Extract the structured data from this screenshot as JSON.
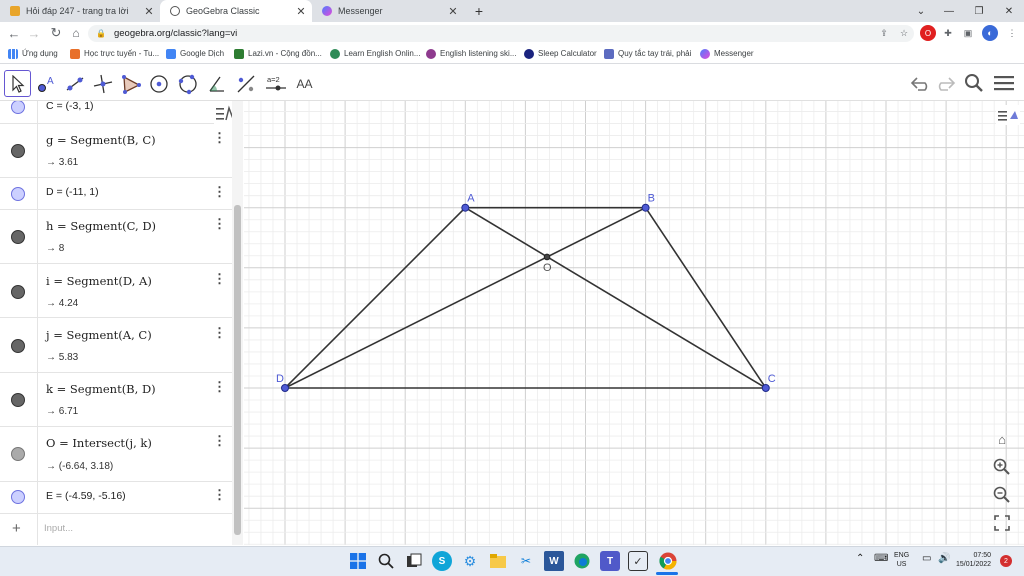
{
  "browser": {
    "tabs": [
      {
        "title": "Hỏi đáp 247 - trang tra lời",
        "active": false
      },
      {
        "title": "GeoGebra Classic",
        "active": true
      },
      {
        "title": "Messenger",
        "active": false
      }
    ],
    "new_tab": "+",
    "url": "geogebra.org/classic?lang=vi",
    "bookmarks": [
      "Ứng dụng",
      "Học trực tuyến - Tu...",
      "Google Dịch",
      "Lazi.vn - Cộng đồn...",
      "Learn English Onlin...",
      "English listening ski...",
      "Sleep Calculator",
      "Quy tắc tay trái, phải",
      "Messenger"
    ]
  },
  "toolbar": {
    "tools": [
      "move",
      "point",
      "line",
      "perpendicular-line",
      "polygon",
      "circle",
      "circle-3-points",
      "angle",
      "reflect",
      "slider",
      "text"
    ],
    "slider_label": "a=2",
    "text_label": "AA"
  },
  "algebra": {
    "input_placeholder": "Input...",
    "add_symbol": "+",
    "rows": [
      {
        "def": "C = (-3, 1)",
        "value": null,
        "marble": "pt"
      },
      {
        "def": "g = Segment(B, C)",
        "value": "→ 3.61",
        "marble": "dk"
      },
      {
        "def": "D = (-11, 1)",
        "value": null,
        "marble": "pt"
      },
      {
        "def": "h = Segment(C, D)",
        "value": "→ 8",
        "marble": "dk"
      },
      {
        "def": "i = Segment(D, A)",
        "value": "→ 4.24",
        "marble": "dk"
      },
      {
        "def": "j = Segment(A, C)",
        "value": "→ 5.83",
        "marble": "dk"
      },
      {
        "def": "k = Segment(B, D)",
        "value": "→ 6.71",
        "marble": "dk"
      },
      {
        "def": "O = Intersect(j, k)",
        "value": "→ (-6.64, 3.18)",
        "marble": "gr"
      },
      {
        "def": "E = (-4.59, -5.16)",
        "value": null,
        "marble": "pt"
      }
    ]
  },
  "geometry": {
    "points": [
      {
        "label": "A",
        "x": -8,
        "y": 4
      },
      {
        "label": "B",
        "x": -5,
        "y": 4
      },
      {
        "label": "C",
        "x": -3,
        "y": 1
      },
      {
        "label": "D",
        "x": -11,
        "y": 1
      },
      {
        "label": "O",
        "x": -6.64,
        "y": 3.18
      }
    ],
    "segments": [
      [
        "A",
        "B"
      ],
      [
        "B",
        "C"
      ],
      [
        "C",
        "D"
      ],
      [
        "D",
        "A"
      ],
      [
        "A",
        "C"
      ],
      [
        "B",
        "D"
      ]
    ]
  },
  "taskbar": {
    "lang": "ENG",
    "region": "US",
    "time": "07:50",
    "date": "15/01/2022",
    "notifications": "2"
  },
  "colors": {
    "point_fill": "#4f5bd5",
    "segment": "#333333",
    "accent": "#6557d2"
  }
}
